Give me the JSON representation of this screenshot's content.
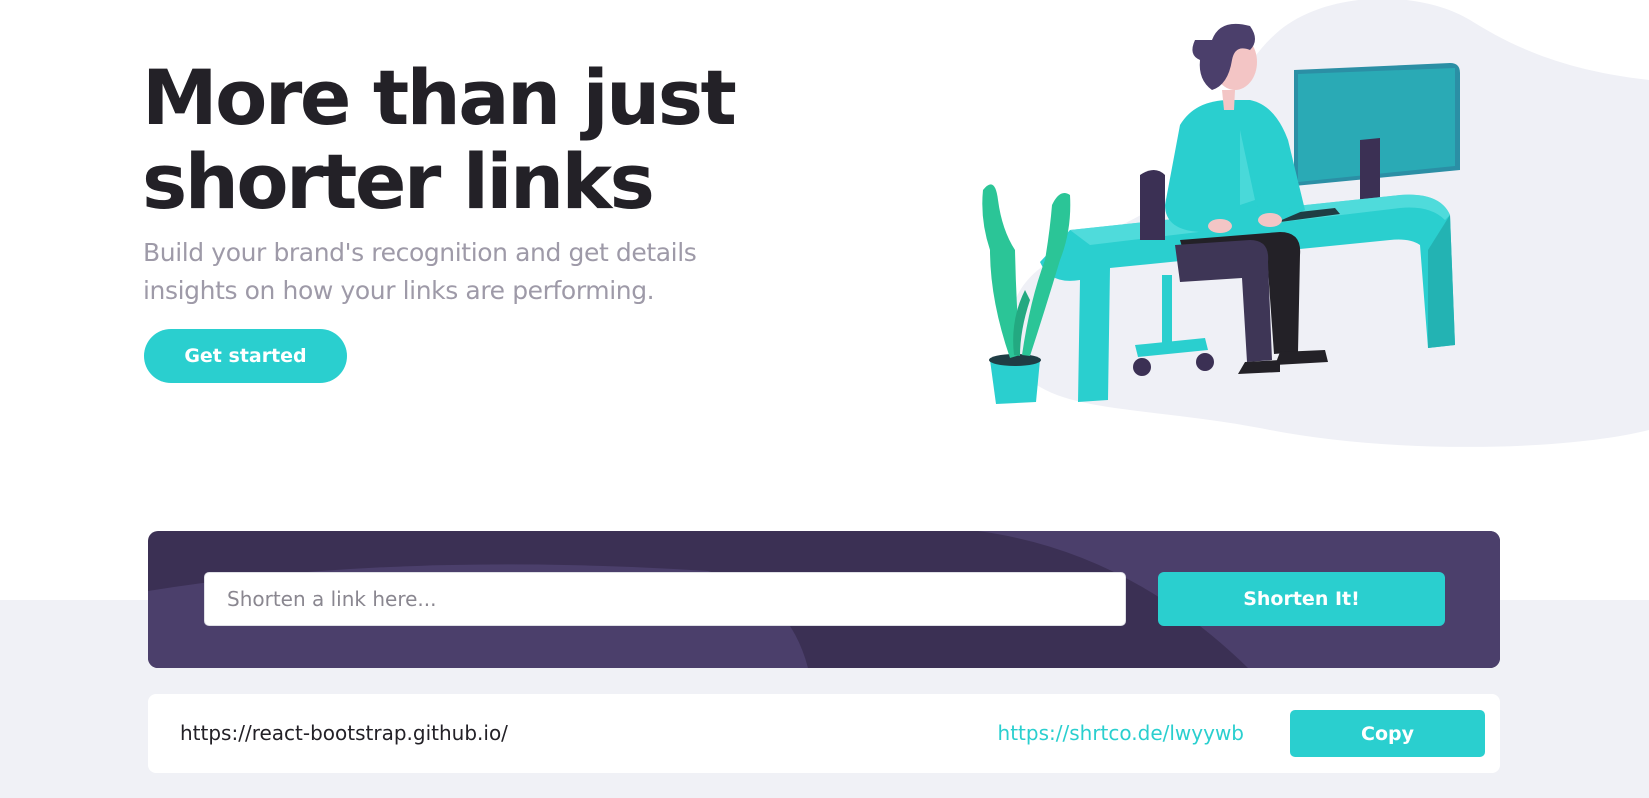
{
  "hero": {
    "title_line1": "More than just",
    "title_line2": "shorter links",
    "subtitle_line1": "Build your brand's recognition and get details",
    "subtitle_line2": "insights on how your links are performing.",
    "cta_label": "Get started"
  },
  "shorten": {
    "placeholder": "Shorten a link here...",
    "button_label": "Shorten It!"
  },
  "results": [
    {
      "original": "https://react-bootstrap.github.io/",
      "short": "https://shrtco.de/lwyywb",
      "copy_label": "Copy"
    }
  ],
  "colors": {
    "accent": "#2acfcf",
    "dark_violet": "#3b3054",
    "heading": "#232127",
    "grey_text": "#9e9aa8",
    "light_bg": "#f0f1f6"
  },
  "icons": {
    "hero_illustration": "person-working-at-desk-illustration"
  }
}
